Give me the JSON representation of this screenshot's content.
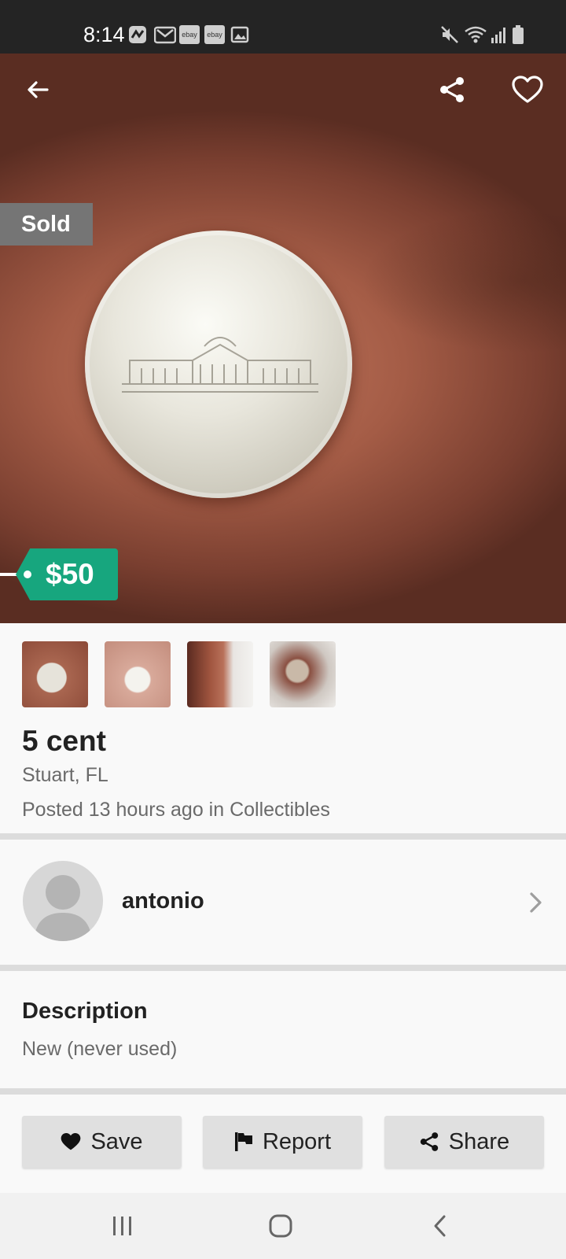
{
  "status_bar": {
    "time": "8:14",
    "notification_icons": [
      "app-icon",
      "gmail-icon",
      "ebay-icon",
      "ebay-icon",
      "image-icon"
    ],
    "ebay_label": "ebay",
    "right_icons": [
      "mute-icon",
      "wifi-icon",
      "signal-icon",
      "battery-icon"
    ]
  },
  "hero": {
    "sold_label": "Sold",
    "price": "$50",
    "price_tag_color": "#17a67e"
  },
  "toolbar": {
    "icons": [
      "back-arrow-icon",
      "share-icon",
      "heart-icon"
    ]
  },
  "thumbnails": [
    "photo-1",
    "photo-2",
    "photo-3",
    "photo-4"
  ],
  "listing": {
    "title": "5 cent",
    "location": "Stuart, FL",
    "posted": "Posted 13 hours ago in Collectibles"
  },
  "seller": {
    "name": "antonio"
  },
  "description": {
    "heading": "Description",
    "text": "New (never used)"
  },
  "actions": {
    "save_label": "Save",
    "report_label": "Report",
    "share_label": "Share"
  },
  "nav_bar": {
    "icons": [
      "recent-apps-icon",
      "home-icon",
      "back-icon"
    ]
  }
}
